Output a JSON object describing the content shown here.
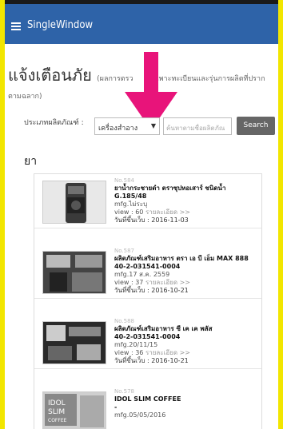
{
  "app": {
    "title": "SingleWindow"
  },
  "heading": {
    "title": "แจ้งเตือนภัย",
    "note_part1": "(ผลการตรว",
    "note_part2": "เฉพาะทะเบียนและรุ่นการผลิตที่ปราก",
    "note_wrap": "ตามฉลาก)"
  },
  "filter": {
    "label": "ประเภทผลิตภัณฑ์ :",
    "selected": "เครื่องสำอาง",
    "search_placeholder": "ค้นหาตามชื่อผลิตภัณ",
    "search_button": "Search"
  },
  "section_title": "ยา",
  "items": [
    {
      "no": "No.584",
      "name_line1": "ยาน้ำกระชายดำ ตราซุปหอเสาร์ ชนิดน้ำ",
      "name_line2": "G.185/48",
      "mfg": "mfg.ไม่ระบุ",
      "view": "view : 60",
      "more": "รายละเอียด >>",
      "date": "วันที่ขึ้นเว็บ : 2016-11-03"
    },
    {
      "no": "No.587",
      "name_line1": "ผลิตภัณฑ์เสริมอาหาร ตรา เอ บี เอ็ม MAX 888",
      "name_line2": "40-2-031541-0004",
      "mfg": "mfg.17 ส.ค. 2559",
      "view": "view : 37",
      "more": "รายละเอียด >>",
      "date": "วันที่ขึ้นเว็บ : 2016-10-21"
    },
    {
      "no": "No.588",
      "name_line1": "ผลิตภัณฑ์เสริมอาหาร ซี เค เค พลัส",
      "name_line2": "40-2-031541-0004",
      "mfg": "mfg.20/11/15",
      "view": "view : 36",
      "more": "รายละเอียด >>",
      "date": "วันที่ขึ้นเว็บ : 2016-10-21"
    },
    {
      "no": "No.578",
      "name_line1": "IDOL SLIM COFFEE",
      "name_line2": "-",
      "mfg": "mfg.05/05/2016",
      "view": "",
      "more": "",
      "date": ""
    }
  ],
  "colors": {
    "topbar": "#2e63a8",
    "arrow": "#e8147a",
    "frame": "#f2e600"
  },
  "icons": [
    "menu-icon",
    "caret-down-icon",
    "arrow-down-icon"
  ]
}
